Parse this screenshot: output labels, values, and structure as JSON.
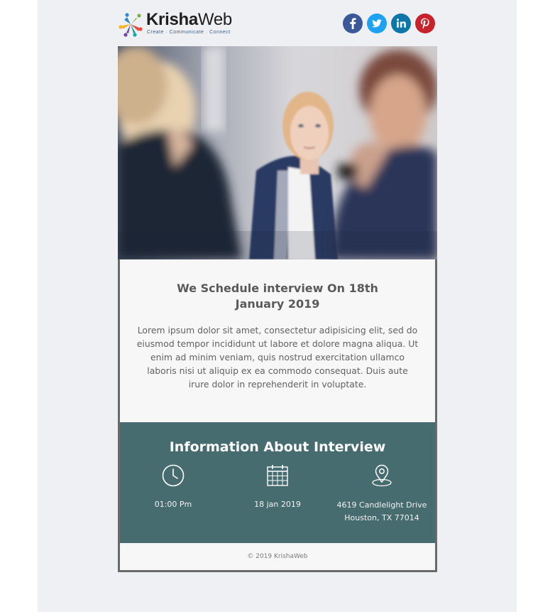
{
  "brand": {
    "name_bold": "Krisha",
    "name_regular": "Web",
    "tagline": "Create · Communicate · Connect"
  },
  "social": [
    {
      "name": "facebook-icon",
      "color": "#3b5998"
    },
    {
      "name": "twitter-icon",
      "color": "#1da1f2"
    },
    {
      "name": "linkedin-icon",
      "color": "#0e76a8"
    },
    {
      "name": "pinterest-icon",
      "color": "#c8232c"
    }
  ],
  "hero": {
    "subject": "interview-photo"
  },
  "intro": {
    "headline": "We Schedule interview On 18th January 2019",
    "body": "Lorem ipsum dolor sit amet, consectetur adipisicing elit, sed do eiusmod tempor incididunt ut labore et dolore magna aliqua. Ut enim ad minim veniam, quis nostrud exercitation ullamco laboris nisi ut aliquip ex ea commodo consequat. Duis aute irure dolor in reprehenderit in voluptate."
  },
  "info": {
    "title": "Information About Interview",
    "time": {
      "icon": "clock-icon",
      "text": "01:00 Pm"
    },
    "date": {
      "icon": "calendar-icon",
      "text": "18 jan 2019"
    },
    "location": {
      "icon": "map-pin-icon",
      "line1": "4619 Candlelight Drive",
      "line2": "Houston, TX 77014"
    }
  },
  "footer": {
    "copyright": "© 2019 KrishaWeb"
  },
  "colors": {
    "info_bg": "#466c70",
    "page_bg": "#eff0f4",
    "card_bg": "#f7f7f7"
  }
}
